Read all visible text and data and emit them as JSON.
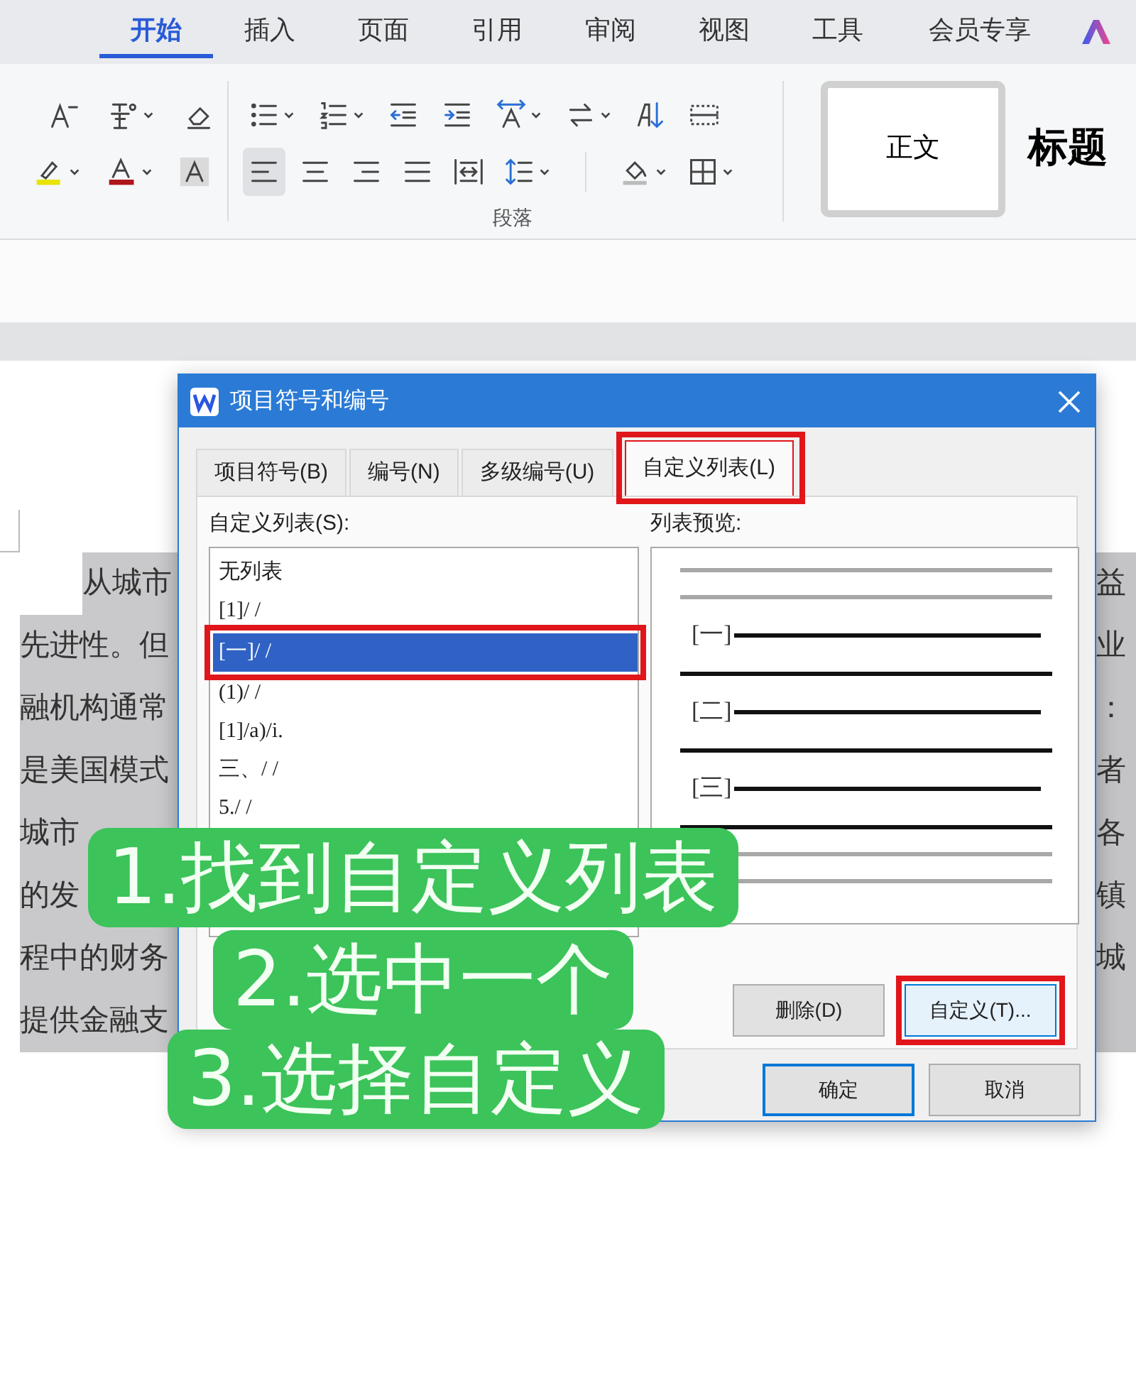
{
  "ribbon_tabs": [
    {
      "label": "开始",
      "selected": true
    },
    {
      "label": "插入",
      "selected": false
    },
    {
      "label": "页面",
      "selected": false
    },
    {
      "label": "引用",
      "selected": false
    },
    {
      "label": "审阅",
      "selected": false
    },
    {
      "label": "视图",
      "selected": false
    },
    {
      "label": "工具",
      "selected": false
    },
    {
      "label": "会员专享",
      "selected": false
    }
  ],
  "ribbon": {
    "group_label": "段落",
    "alignment_buttons": [
      {
        "selected": true
      },
      {
        "selected": false
      },
      {
        "selected": false
      },
      {
        "selected": false
      },
      {
        "selected": false
      }
    ],
    "styles": [
      {
        "label": "正文",
        "kind": "body",
        "selected": true
      },
      {
        "label": "标题",
        "kind": "heading",
        "selected": false
      }
    ]
  },
  "document": {
    "lines": [
      {
        "left": "从城市",
        "right": "益",
        "indent": true
      },
      {
        "left": "先进性。但",
        "right": "业",
        "indent": false
      },
      {
        "left": "融机构通常",
        "right": "：",
        "indent": false
      },
      {
        "left": "是美国模式",
        "right": "者",
        "indent": false
      },
      {
        "left": "城市",
        "right": "各",
        "indent": false
      },
      {
        "left": "的发",
        "right": "镇",
        "indent": false
      },
      {
        "left": "程中的财务",
        "right": "城",
        "indent": false
      },
      {
        "left": "提供金融支",
        "indent": false
      }
    ]
  },
  "dialog": {
    "title": "项目符号和编号",
    "tabs": [
      {
        "label": "项目符号(B)",
        "selected": false,
        "highlighted": false
      },
      {
        "label": "编号(N)",
        "selected": false,
        "highlighted": false
      },
      {
        "label": "多级编号(U)",
        "selected": false,
        "highlighted": false
      },
      {
        "label": "自定义列表(L)",
        "selected": true,
        "highlighted": true
      }
    ],
    "list_label": "自定义列表(S):",
    "list_items": [
      {
        "label": "无列表",
        "selected": false,
        "highlighted": false
      },
      {
        "label": "[1]/ /",
        "selected": false,
        "highlighted": false
      },
      {
        "label": "[一]/ /",
        "selected": true,
        "highlighted": true
      },
      {
        "label": "(1)/ /",
        "selected": false,
        "highlighted": false
      },
      {
        "label": "[1]/a)/i.",
        "selected": false,
        "highlighted": false
      },
      {
        "label": "三、/ /",
        "selected": false,
        "highlighted": false
      },
      {
        "label": "5./ /",
        "selected": false,
        "highlighted": false
      }
    ],
    "preview_label": "列表预览:",
    "preview_items": [
      "[一]",
      "[二]",
      "[三]"
    ],
    "action_buttons": [
      {
        "label": "删除(D)",
        "highlighted": false
      },
      {
        "label": "自定义(T)...",
        "highlighted": true
      }
    ],
    "footer_buttons": [
      {
        "label": "确定",
        "default": true
      },
      {
        "label": "取消",
        "default": false
      }
    ]
  },
  "captions": [
    "1.找到自定义列表",
    "2.选中一个",
    "3.选择自定义"
  ]
}
